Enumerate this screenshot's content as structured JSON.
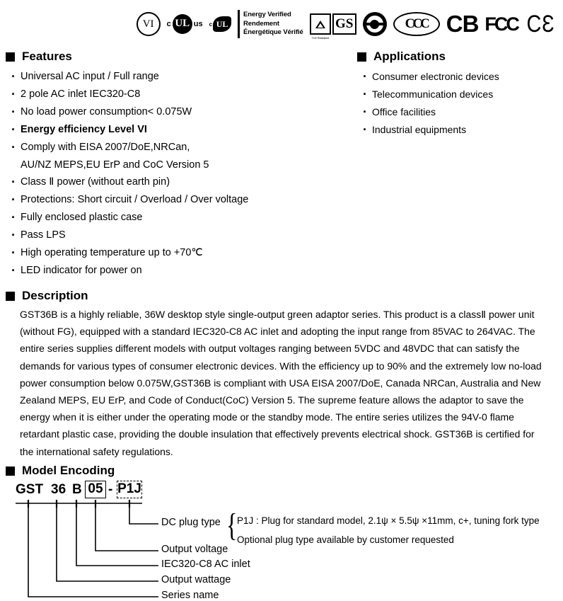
{
  "certifications": [
    {
      "name": "energy-level-vi-mark",
      "label": "VI"
    },
    {
      "name": "ul-cus-mark",
      "label": "c UL us",
      "prefix": "c",
      "core": "UL",
      "suffix": "us"
    },
    {
      "name": "ul-energy-verified-mark",
      "prefix": "c",
      "core": "UL"
    },
    {
      "name": "energy-verified-text-mark",
      "lines": [
        "Energy Verified",
        "Rendement",
        "Énergétique Vérifié"
      ]
    },
    {
      "name": "tuv-gs-mark",
      "gs": "GS",
      "caption": "TUV Rheinland"
    },
    {
      "name": "ccee-mark",
      "label": ""
    },
    {
      "name": "ccc-mark",
      "label": "CCC"
    },
    {
      "name": "cb-mark",
      "label": "CB"
    },
    {
      "name": "fcc-mark",
      "label": "FCC"
    },
    {
      "name": "ce-mark",
      "label": "CƐ"
    }
  ],
  "features": {
    "heading": "Features",
    "items": [
      {
        "text": "Universal AC input / Full range",
        "bold": false
      },
      {
        "text": "2 pole AC inlet IEC320-C8",
        "bold": false
      },
      {
        "text": "No load power consumption< 0.075W",
        "bold": false
      },
      {
        "text": "Energy efficiency  Level  VI",
        "bold": true
      },
      {
        "text": "Comply with EISA 2007/DoE,NRCan,",
        "bold": false,
        "cont": "AU/NZ MEPS,EU ErP and CoC Version 5"
      },
      {
        "text": "Class Ⅱ power (without earth pin)",
        "bold": false
      },
      {
        "text": "Protections: Short circuit / Overload / Over voltage",
        "bold": false
      },
      {
        "text": "Fully enclosed plastic case",
        "bold": false
      },
      {
        "text": "Pass LPS",
        "bold": false
      },
      {
        "text": "High operating temperature up to +70℃",
        "bold": false
      },
      {
        "text": "LED indicator for power on",
        "bold": false
      }
    ]
  },
  "applications": {
    "heading": "Applications",
    "items": [
      {
        "text": "Consumer electronic devices"
      },
      {
        "text": "Telecommunication devices"
      },
      {
        "text": "Office facilities"
      },
      {
        "text": "Industrial equipments"
      }
    ]
  },
  "description": {
    "heading": "Description",
    "body": "GST36B is a highly reliable, 36W desktop style single-output green adaptor series. This product is a classⅡ power unit (without FG), equipped with a standard IEC320-C8 AC inlet and adopting the input range from 85VAC to 264VAC. The entire series supplies different models with output voltages ranging between 5VDC and 48VDC that can satisfy the demands for various types of consumer electronic devices. With the efficiency up to 90% and the extremely low no-load power consumption below 0.075W,GST36B is compliant with USA EISA 2007/DoE, Canada NRCan, Australia and New Zealand MEPS, EU ErP, and Code of Conduct(CoC) Version 5. The supreme feature allows the adaptor to save the energy when it is either under the operating mode or the standby mode. The entire series utilizes the 94V-0 flame retardant plastic case, providing the double insulation that effectively prevents electrical shock. GST36B is certified for the international safety regulations."
  },
  "model_encoding": {
    "heading": "Model Encoding",
    "tokens": {
      "series": "GST",
      "wattage": "36",
      "inlet": "B",
      "voltage": "05",
      "dash": "-",
      "plug": "P1J"
    },
    "labels": {
      "dc_plug_type": "DC plug type",
      "output_voltage": "Output voltage",
      "ac_inlet": "IEC320-C8 AC inlet",
      "output_wattage": "Output wattage",
      "series_name": "Series name"
    },
    "plug_options": [
      "P1J : Plug for standard model, 2.1ψ × 5.5ψ ×11mm, c+, tuning fork type",
      "Optional plug type available by customer requested"
    ]
  },
  "colors": {
    "text": "#000000",
    "background": "#ffffff"
  }
}
